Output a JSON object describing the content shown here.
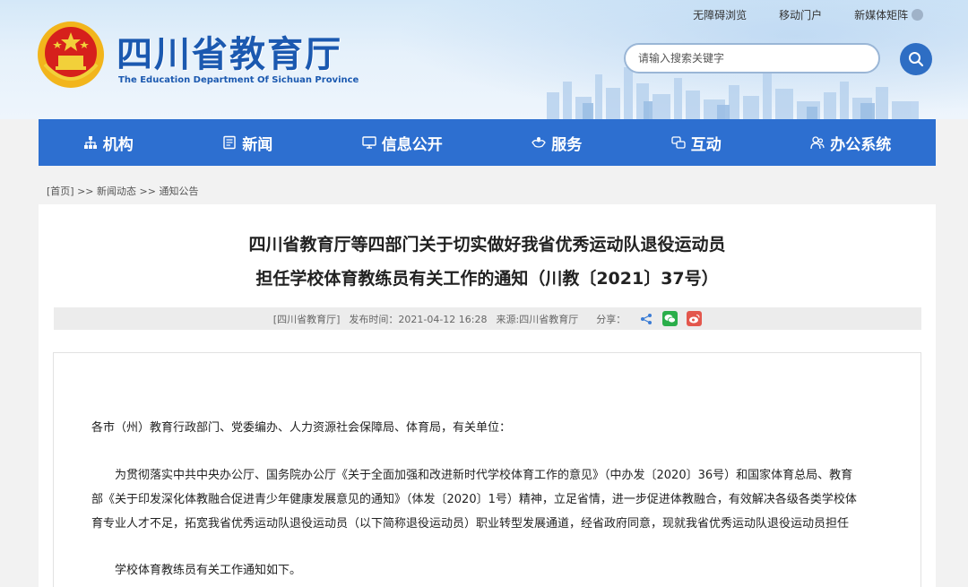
{
  "header": {
    "title": "四川省教育厅",
    "subtitle": "The Education Department Of Sichuan Province",
    "top_links": [
      "无障碍浏览",
      "移动门户",
      "新媒体矩阵"
    ],
    "search_placeholder": "请输入搜索关键字"
  },
  "nav": {
    "items": [
      {
        "label": "机构",
        "icon": "org-icon"
      },
      {
        "label": "新闻",
        "icon": "news-icon"
      },
      {
        "label": "信息公开",
        "icon": "monitor-icon"
      },
      {
        "label": "服务",
        "icon": "service-icon"
      },
      {
        "label": "互动",
        "icon": "chat-icon"
      },
      {
        "label": "办公系统",
        "icon": "people-icon"
      }
    ]
  },
  "breadcrumb": {
    "home": "[首页]",
    "sep1": ">>",
    "level1": "新闻动态",
    "sep2": ">>",
    "level2": "通知公告"
  },
  "article": {
    "title_line1": "四川省教育厅等四部门关于切实做好我省优秀运动队退役运动员",
    "title_line2": "担任学校体育教练员有关工作的通知（川教〔2021〕37号）",
    "meta": {
      "org": "[四川省教育厅]",
      "published": "发布时间：2021-04-12 16:28",
      "source": "来源:四川省教育厅",
      "share_label": "分享："
    },
    "greeting": "各市（州）教育行政部门、党委编办、人力资源社会保障局、体育局，有关单位：",
    "para1_line1": "为贯彻落实中共中央办公厅、国务院办公厅《关于全面加强和改进新时代学校体育工作的意见》（中办发〔2020〕36号）和国家体育总局、教育",
    "para1_line2": "部《关于印发深化体教融合促进青少年健康发展意见的通知》（体发〔2020〕1号）精神，立足省情，进一步促进体教融合，有效解决各级各类学校体",
    "para1_line3": "育专业人才不足，拓宽我省优秀运动队退役运动员（以下简称退役运动员）职业转型发展通道，经省政府同意，现就我省优秀运动队退役运动员担任",
    "para2": "学校体育教练员有关工作通知如下。"
  },
  "colors": {
    "nav_bg": "#2d6fd0",
    "title_blue": "#1b59b0",
    "wechat_green": "#2aae4a",
    "weibo_red": "#e3574d"
  }
}
